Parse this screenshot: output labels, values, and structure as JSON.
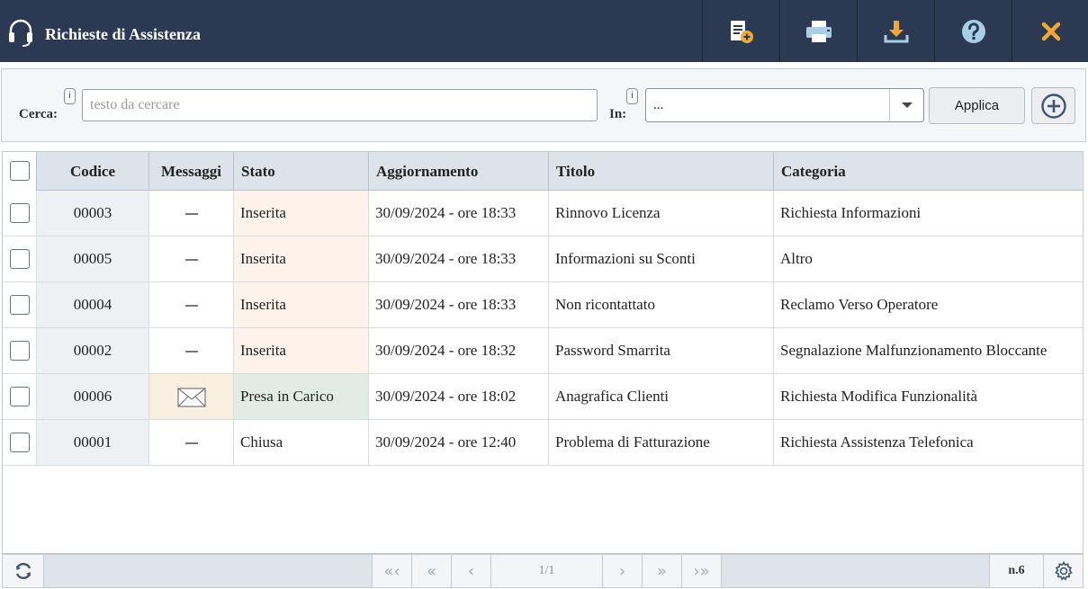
{
  "header": {
    "title": "Richieste di Assistenza",
    "icons": [
      "headset-icon",
      "new-document-icon",
      "print-icon",
      "download-icon",
      "help-icon",
      "close-icon"
    ],
    "accent_color": "#f0a830"
  },
  "filter": {
    "search_label": "Cerca:",
    "search_placeholder": "testo da cercare",
    "search_value": "",
    "in_label": "In:",
    "in_value": "...",
    "info_badge": "i",
    "apply_label": "Applica"
  },
  "table": {
    "columns": [
      "Codice",
      "Messaggi",
      "Stato",
      "Aggiornamento",
      "Titolo",
      "Categoria"
    ],
    "rows": [
      {
        "codice": "00003",
        "messaggi": "dash",
        "stato": "Inserita",
        "aggiornamento": "30/09/2024 - ore 18:33",
        "titolo": "Rinnovo Licenza",
        "categoria": "Richiesta Informazioni"
      },
      {
        "codice": "00005",
        "messaggi": "dash",
        "stato": "Inserita",
        "aggiornamento": "30/09/2024 - ore 18:33",
        "titolo": "Informazioni su Sconti",
        "categoria": "Altro"
      },
      {
        "codice": "00004",
        "messaggi": "dash",
        "stato": "Inserita",
        "aggiornamento": "30/09/2024 - ore 18:33",
        "titolo": "Non ricontattato",
        "categoria": "Reclamo Verso Operatore"
      },
      {
        "codice": "00002",
        "messaggi": "dash",
        "stato": "Inserita",
        "aggiornamento": "30/09/2024 - ore 18:32",
        "titolo": "Password Smarrita",
        "categoria": "Segnalazione Malfunzionamento Bloccante"
      },
      {
        "codice": "00006",
        "messaggi": "envelope",
        "stato": "Presa in Carico",
        "aggiornamento": "30/09/2024 - ore 18:02",
        "titolo": "Anagrafica Clienti",
        "categoria": "Richiesta Modifica Funzionalità"
      },
      {
        "codice": "00001",
        "messaggi": "dash",
        "stato": "Chiusa",
        "aggiornamento": "30/09/2024 - ore 12:40",
        "titolo": "Problema di Fatturazione",
        "categoria": "Richiesta Assistenza Telefonica"
      }
    ],
    "status_colors": {
      "Inserita": "#fdf3ea",
      "Presa in Carico": "#e1ece6",
      "Chiusa": "#ffffff"
    },
    "envelope_bg": "#f8efe0"
  },
  "footer": {
    "page": "1/1",
    "count": "n.6",
    "icons": [
      "refresh-icon",
      "first-page-icon",
      "prev-fast-icon",
      "prev-page-icon",
      "next-page-icon",
      "next-fast-icon",
      "last-page-icon",
      "settings-icon"
    ]
  }
}
